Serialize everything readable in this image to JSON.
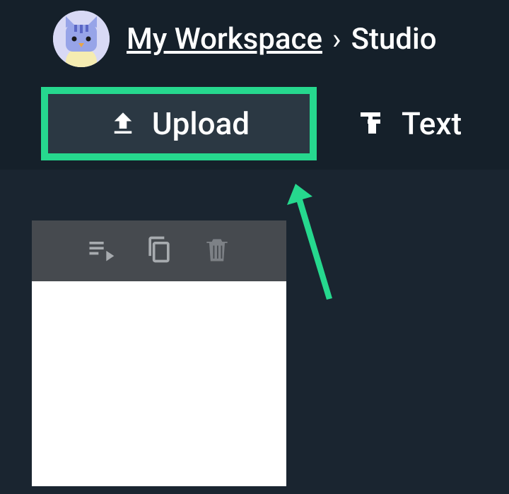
{
  "breadcrumb": {
    "workspace_label": "My Workspace",
    "separator": "›",
    "current": "Studio"
  },
  "tabs": {
    "upload_label": "Upload",
    "text_label": "Text"
  },
  "highlight_color": "#26d88e"
}
